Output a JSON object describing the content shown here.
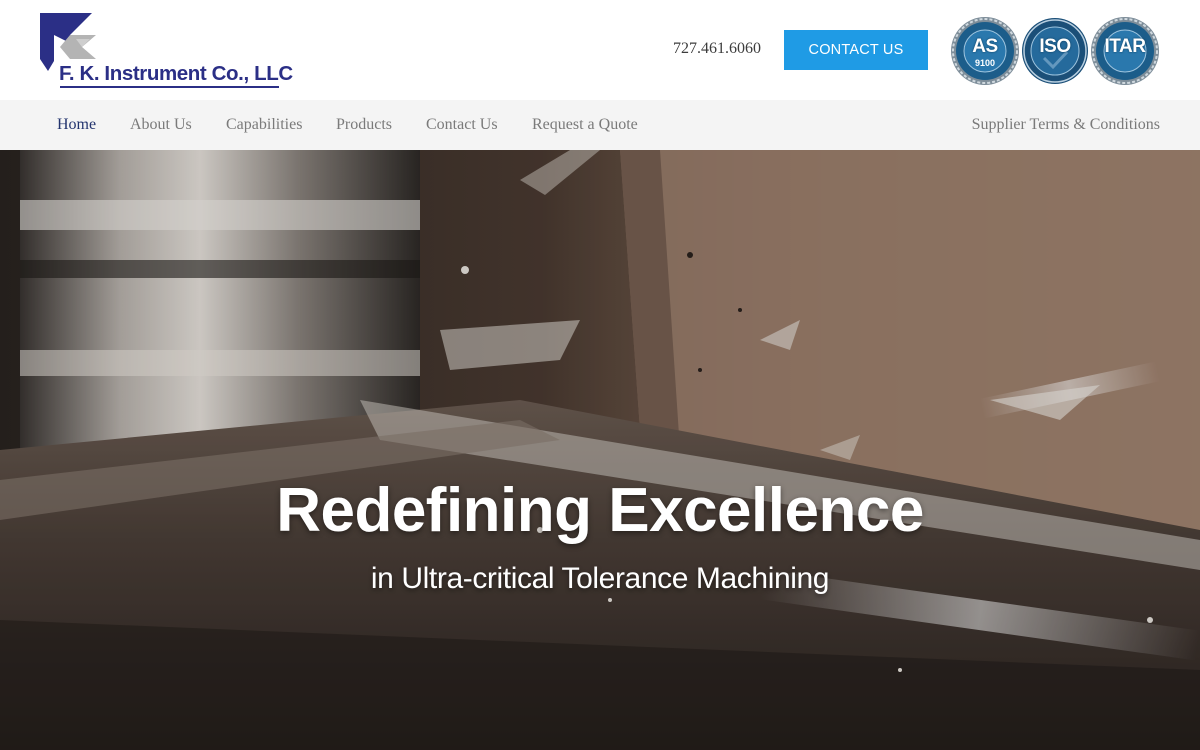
{
  "brand": {
    "name": "F. K. Instrument Co., LLC",
    "logo_icon": "fk-logo-mark",
    "colors": {
      "navy": "#2b2f86",
      "gray": "#9a9a9a"
    }
  },
  "header": {
    "phone": "727.461.6060",
    "contact_label": "CONTACT US",
    "contact_color": "#1f9be5",
    "badges": [
      {
        "icon": "as9100-seal-icon",
        "label": "AS",
        "sub": "9100"
      },
      {
        "icon": "iso-seal-icon",
        "label": "ISO",
        "sub": ""
      },
      {
        "icon": "itar-seal-icon",
        "label": "ITAR",
        "sub": ""
      }
    ]
  },
  "nav": {
    "items": [
      {
        "label": "Home",
        "active": true
      },
      {
        "label": "About Us"
      },
      {
        "label": "Capabilities"
      },
      {
        "label": "Products"
      },
      {
        "label": "Contact Us"
      },
      {
        "label": "Request a Quote"
      }
    ],
    "terms": "Supplier Terms & Conditions"
  },
  "hero": {
    "title": "Redefining Excellence",
    "subtitle": "in Ultra-critical Tolerance Machining",
    "image": "cnc-end-mill-cutting-metal-photo"
  }
}
